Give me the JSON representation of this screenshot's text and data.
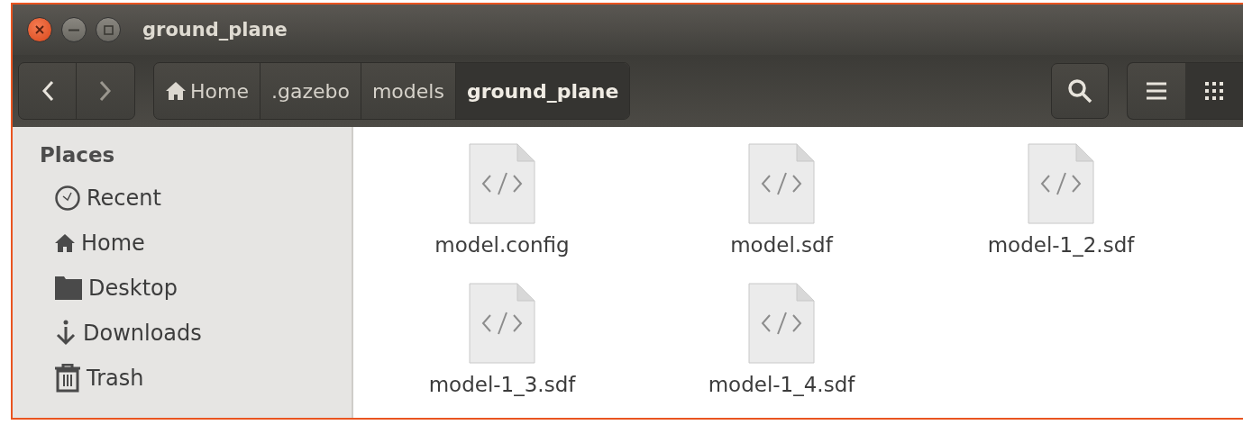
{
  "window": {
    "title": "ground_plane"
  },
  "window_controls": [
    {
      "kind": "close"
    },
    {
      "kind": "minimize"
    },
    {
      "kind": "maximize"
    }
  ],
  "nav": [
    {
      "kind": "back",
      "disabled": false
    },
    {
      "kind": "forward",
      "disabled": true
    }
  ],
  "breadcrumb": [
    {
      "label": "Home",
      "kind": "home",
      "selected": false
    },
    {
      "label": ".gazebo",
      "kind": "plain",
      "selected": false
    },
    {
      "label": "models",
      "kind": "plain",
      "selected": false
    },
    {
      "label": "ground_plane",
      "kind": "plain",
      "selected": true
    }
  ],
  "views": [
    {
      "kind": "list",
      "selected": false
    },
    {
      "kind": "grid",
      "selected": true
    }
  ],
  "sidebar": {
    "heading": "Places",
    "items": [
      {
        "label": "Recent",
        "kind": "recent"
      },
      {
        "label": "Home",
        "kind": "home"
      },
      {
        "label": "Desktop",
        "kind": "folder"
      },
      {
        "label": "Downloads",
        "kind": "downloads"
      },
      {
        "label": "Trash",
        "kind": "trash"
      }
    ]
  },
  "files": [
    {
      "name": "model.config"
    },
    {
      "name": "model.sdf"
    },
    {
      "name": "model-1_2.sdf"
    },
    {
      "name": "model-1_3.sdf"
    },
    {
      "name": "model-1_4.sdf"
    }
  ]
}
